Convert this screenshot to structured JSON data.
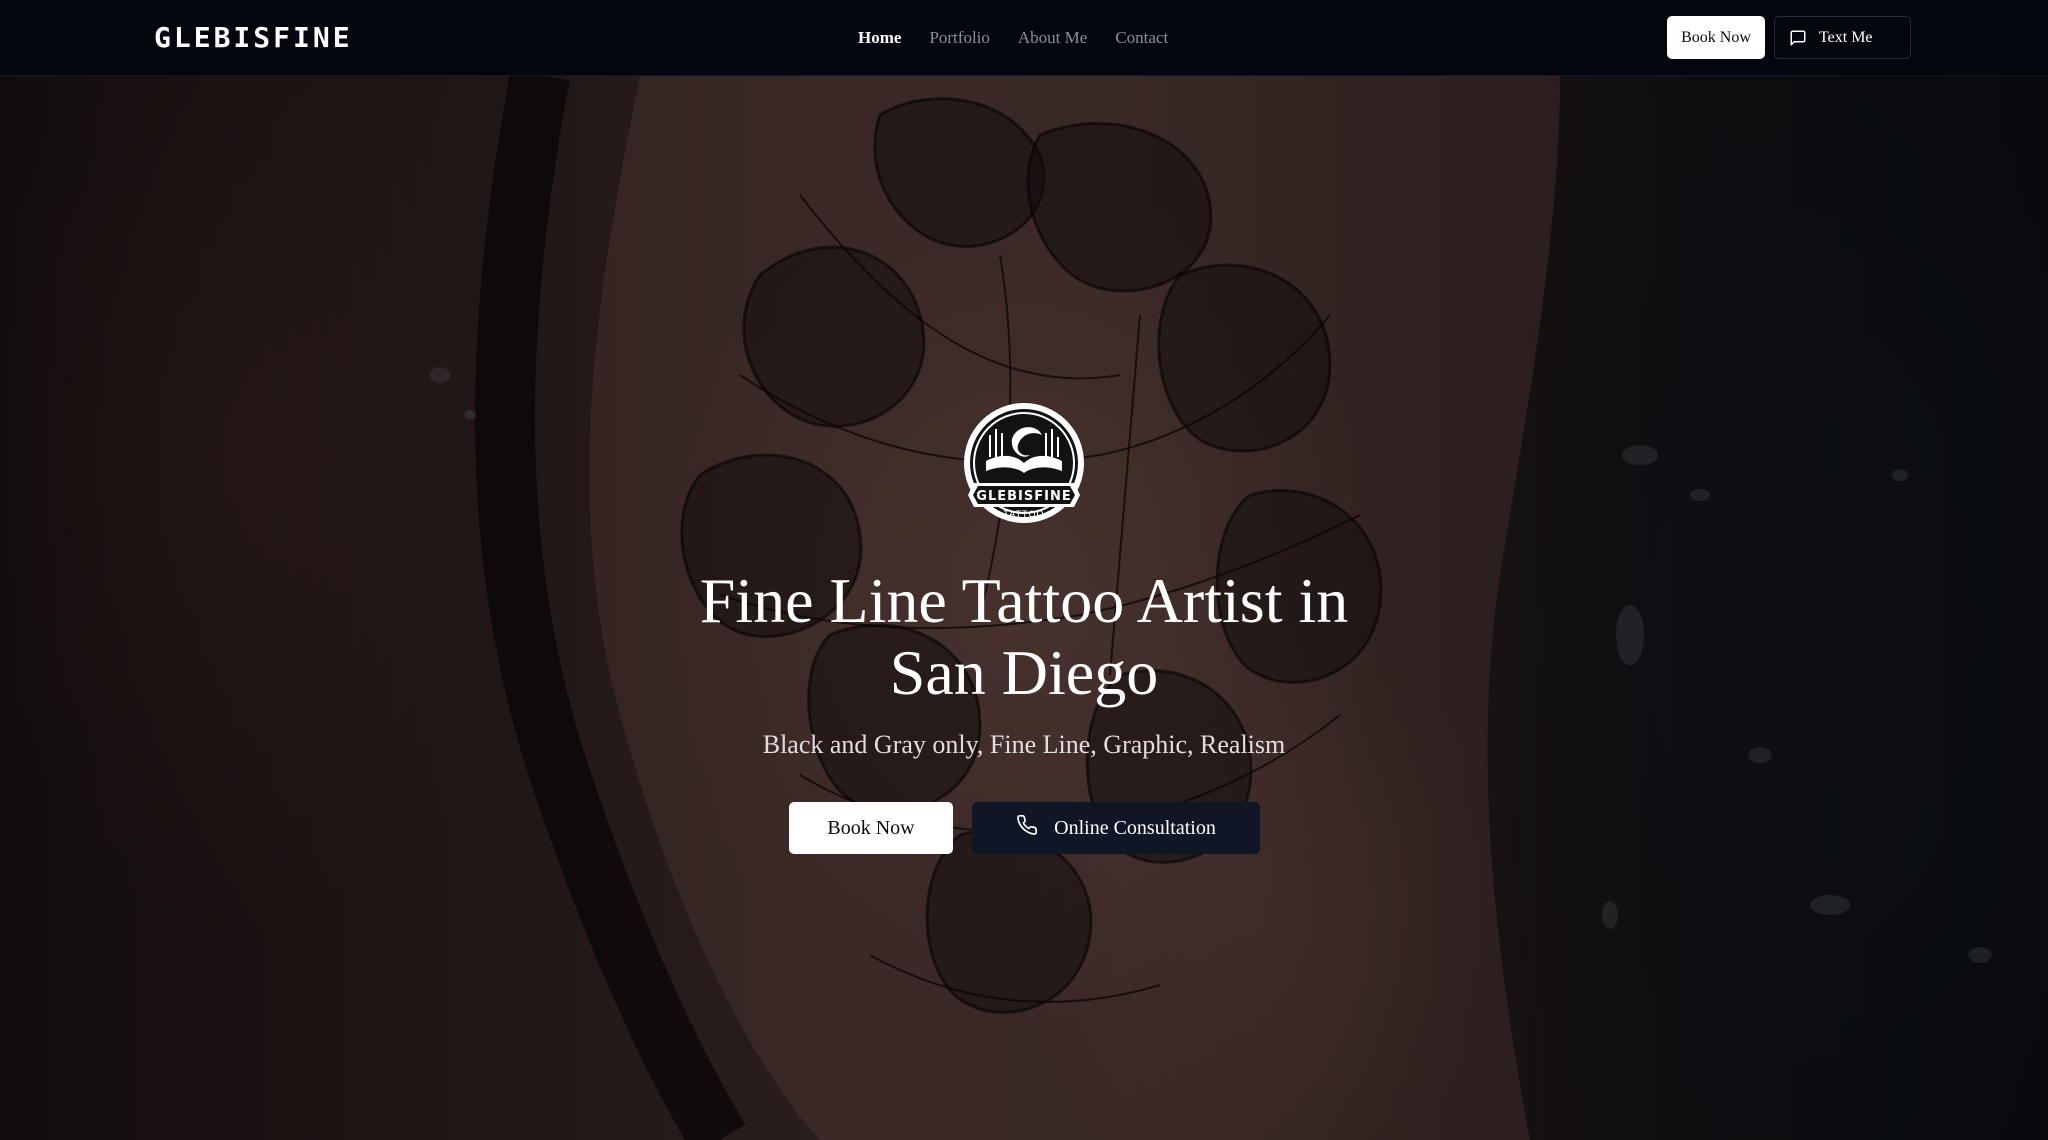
{
  "header": {
    "brand": "GLEBISFINE",
    "nav": [
      {
        "label": "Home",
        "active": true
      },
      {
        "label": "Portfolio",
        "active": false
      },
      {
        "label": "About Me",
        "active": false
      },
      {
        "label": "Contact",
        "active": false
      }
    ],
    "book_label": "Book Now",
    "text_label": "Text Me",
    "text_icon": "message-square-icon"
  },
  "hero": {
    "logo": {
      "name": "GLEBISFINE",
      "sub": "TATTOO"
    },
    "title_line1": "Fine Line Tattoo Artist in",
    "title_line2": "San Diego",
    "subtitle": "Black and Gray only, Fine Line, Graphic, Realism",
    "book_label": "Book Now",
    "consult_label": "Online Consultation",
    "consult_icon": "phone-icon"
  },
  "colors": {
    "navbar_bg": "#04060f",
    "primary_button_bg": "#ffffff",
    "secondary_button_bg": "#0f1626",
    "nav_inactive": "#8c8f9a"
  }
}
